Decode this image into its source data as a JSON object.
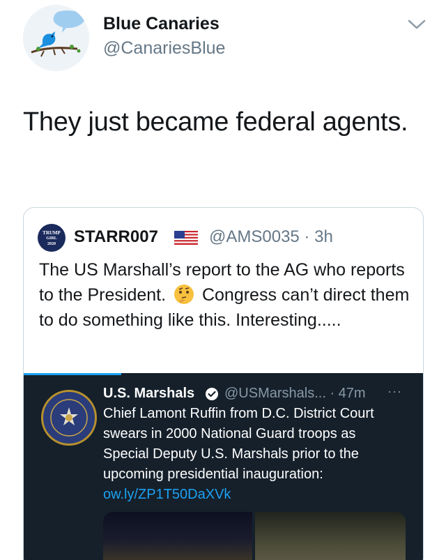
{
  "tweet": {
    "author_name": "Blue Canaries",
    "author_handle": "@CanariesBlue",
    "text": "They just became federal agents."
  },
  "quoted": {
    "author_name": "STARR007",
    "author_flag": "us-flag-emoji",
    "handle_time": "@AMS0035 · 3h",
    "avatar_text": [
      "TRUMP",
      "GIRL",
      "2020"
    ],
    "text_part1": "The US Marshall’s report to the AG who reports to the President.",
    "emoji": "thinking-face-emoji",
    "text_part2": "Congress can’t direct them to do something like this. Interesting....."
  },
  "embedded": {
    "author_name": "U.S. Marshals",
    "meta": "@USMarshals... · 47m",
    "more": "···",
    "text": "Chief Lamont Ruffin from D.C. District Court swears in 2000 National Guard troops as Special Deputy U.S. Marshals prior to the upcoming presidential inauguration:",
    "link": "ow.ly/ZP1T50DaXVk"
  },
  "colors": {
    "link_blue": "#1da1f2",
    "dark_bg": "#15202b",
    "muted_gray": "#657786"
  }
}
